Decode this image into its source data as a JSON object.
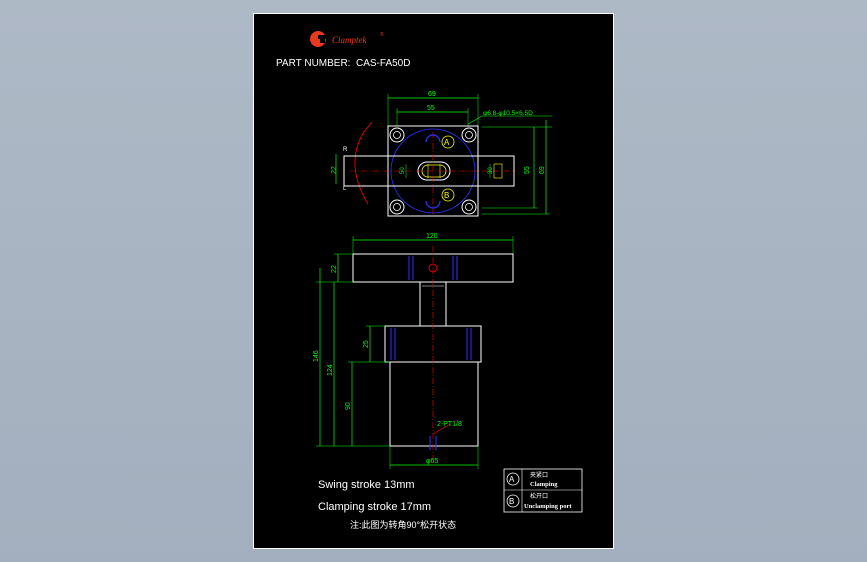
{
  "brand": {
    "name": "Clamptek",
    "reg_mark": "®",
    "logo_colors": {
      "primary": "#e83a1c"
    }
  },
  "part_number_label": "PART NUMBER:",
  "part_number": "CAS-FA50D",
  "top_view": {
    "dim_width_outer": "69",
    "dim_width_inner": "55",
    "dim_hole_note": "φ6.8-φ10.5×6.5D",
    "dim_height_left": "22",
    "dim_inner_50": "50",
    "dim_inner_30": "30",
    "dim_right_55": "55",
    "dim_right_69": "69",
    "rotation_r": "R",
    "rotation_l": "L",
    "port_a": "A",
    "port_b": "B"
  },
  "side_view": {
    "dim_arm_length": "120",
    "dim_arm_height": "22",
    "dim_total_146": "146",
    "dim_body_124": "124",
    "dim_body_90": "90",
    "dim_flange_25": "25",
    "dim_port_note": "2-PT1/8",
    "dim_diameter": "φ65"
  },
  "notes": {
    "swing_stroke": "Swing stroke 13mm",
    "clamping_stroke": "Clamping stroke 17mm",
    "footnote": "注:此图为转角90°松开状态"
  },
  "legend": {
    "rows": [
      {
        "symbol": "A",
        "label_cn": "夹紧口",
        "label_en": "Clamping"
      },
      {
        "symbol": "B",
        "label_cn": "松开口",
        "label_en": "Unclamping port"
      }
    ]
  },
  "colors": {
    "background": "#a9b4c2",
    "sheet": "#000000",
    "outline": "#ffffff",
    "dimension": "#00ff00",
    "accent": "#ff0000",
    "center_line": "#3030ff",
    "highlight": "#ffff00"
  }
}
